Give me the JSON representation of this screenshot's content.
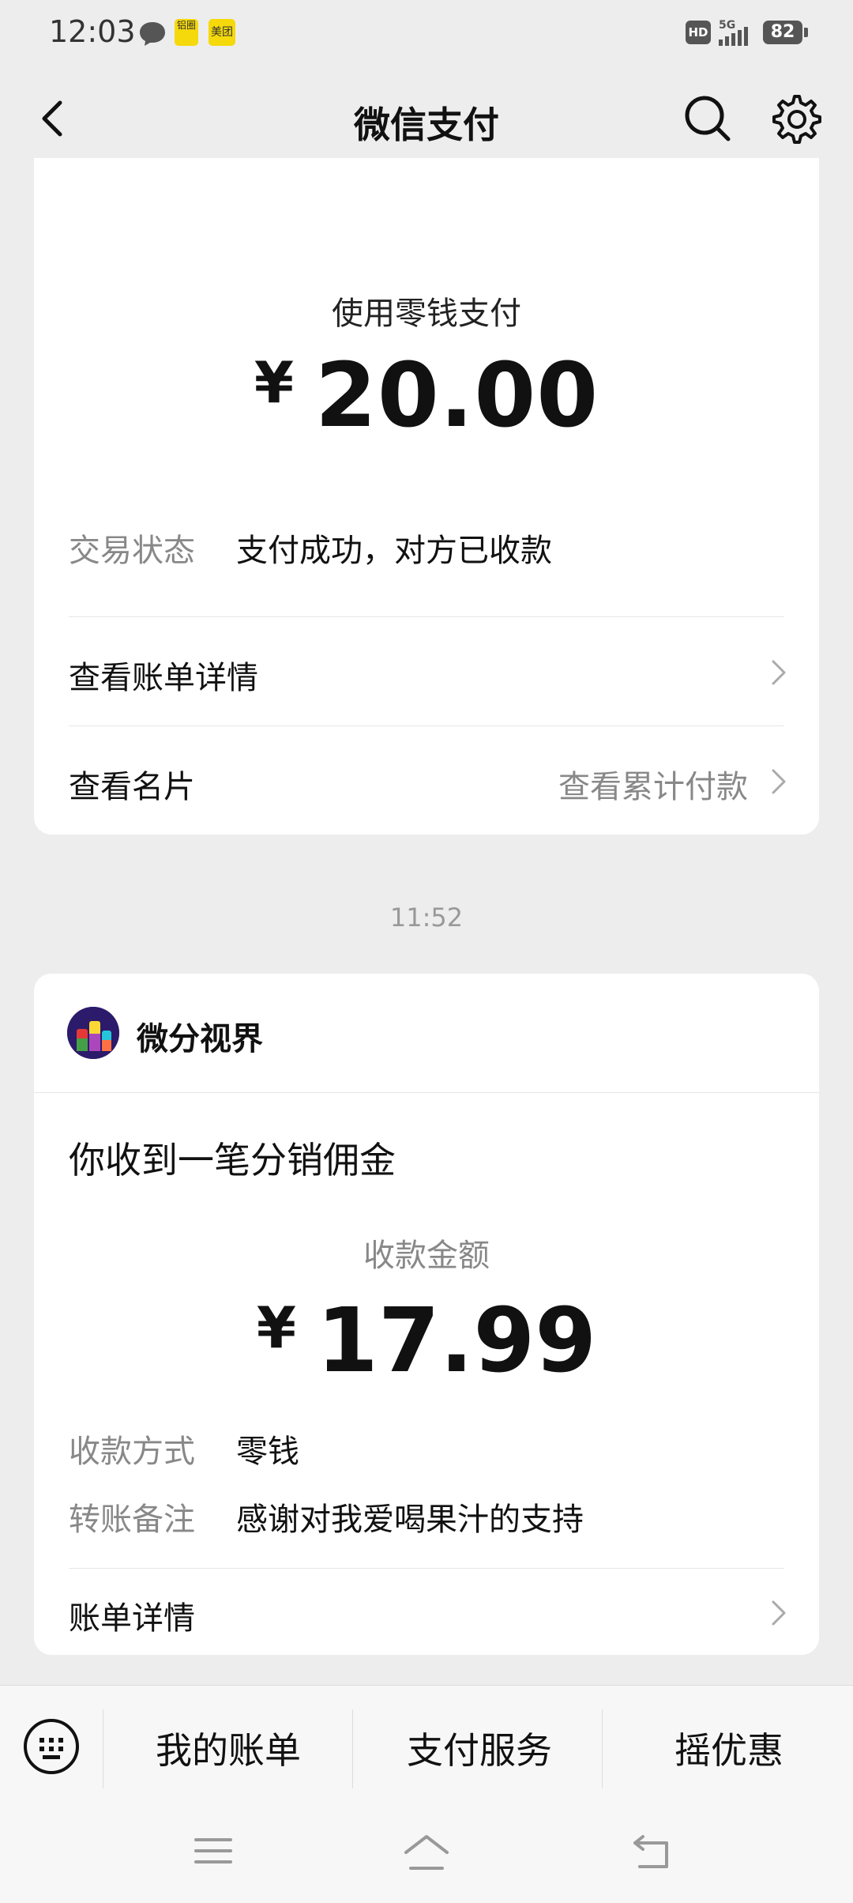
{
  "status_bar": {
    "time": "12:03",
    "app1_label": "铝圈",
    "app2_label": "美团",
    "network": "HD",
    "signal": "5G",
    "battery": "82"
  },
  "nav": {
    "title": "微信支付"
  },
  "payment_card": {
    "label": "使用零钱支付",
    "currency": "¥",
    "amount": "20.00",
    "status_key": "交易状态",
    "status_value": "支付成功，对方已收款",
    "bill_detail": "查看账单详情",
    "view_card": "查看名片",
    "view_cumulative": "查看累计付款"
  },
  "timestamp": "11:52",
  "receipt_card": {
    "merchant": "微分视界",
    "notice": "你收到一笔分销佣金",
    "amount_label": "收款金额",
    "currency": "¥",
    "amount": "17.99",
    "method_key": "收款方式",
    "method_value": "零钱",
    "remark_key": "转账备注",
    "remark_value": "感谢对我爱喝果汁的支持",
    "bill_detail": "账单详情"
  },
  "tabbar": {
    "tabs": [
      "我的账单",
      "支付服务",
      "摇优惠"
    ]
  }
}
